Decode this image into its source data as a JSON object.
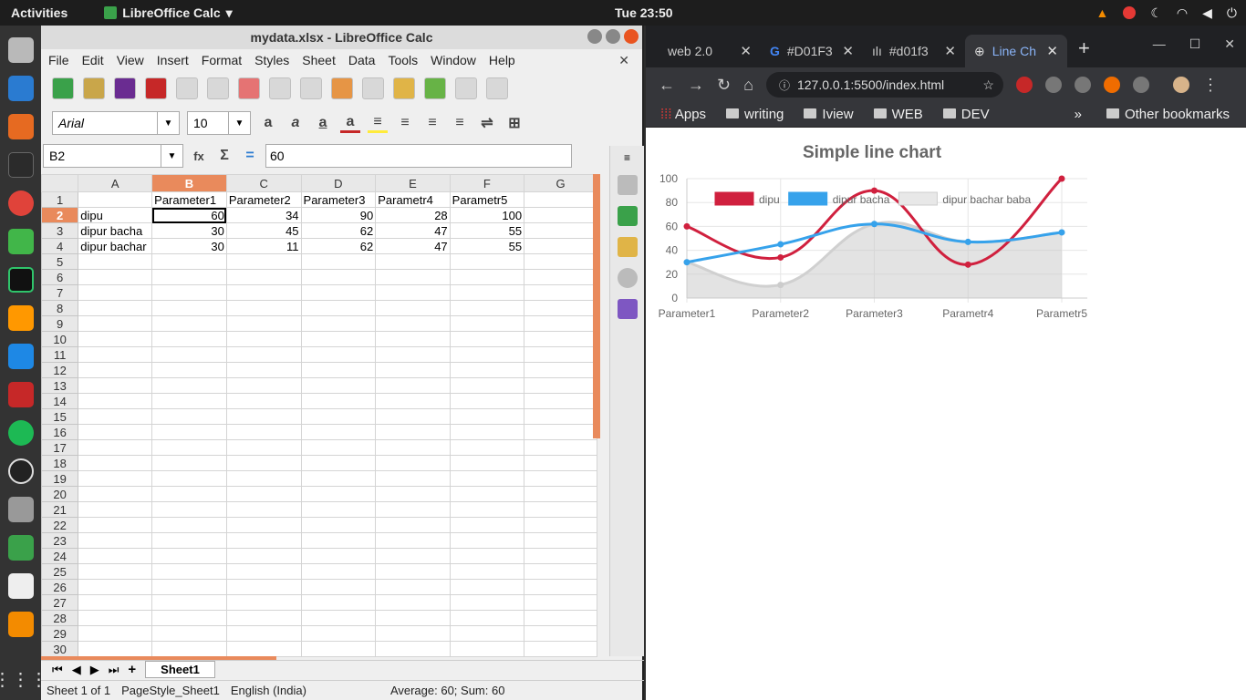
{
  "topbar": {
    "activities": "Activities",
    "app_name": "LibreOffice Calc",
    "clock": "Tue 23:50"
  },
  "calc": {
    "title": "mydata.xlsx - LibreOffice Calc",
    "menu": [
      "File",
      "Edit",
      "View",
      "Insert",
      "Format",
      "Styles",
      "Sheet",
      "Data",
      "Tools",
      "Window",
      "Help"
    ],
    "font_name": "Arial",
    "font_size": "10",
    "name_box": "B2",
    "formula_value": "60",
    "col_headers": [
      "A",
      "B",
      "C",
      "D",
      "E",
      "F",
      "G"
    ],
    "rows": [
      [
        "",
        "Parameter1",
        "Parameter2",
        "Parameter3",
        "Parametr4",
        "Parametr5",
        ""
      ],
      [
        "dipu",
        "60",
        "34",
        "90",
        "28",
        "100",
        ""
      ],
      [
        "dipur bacha",
        "30",
        "45",
        "62",
        "47",
        "55",
        ""
      ],
      [
        "dipur bachar",
        "30",
        "11",
        "62",
        "47",
        "55",
        ""
      ]
    ],
    "row_count": 30,
    "sheet_tab": "Sheet1",
    "status": {
      "sheet": "Sheet 1 of 1",
      "style": "PageStyle_Sheet1",
      "lang": "English (India)",
      "sum": "Average: 60; Sum: 60"
    }
  },
  "browser": {
    "tabs": [
      "web 2.0",
      "#D01F3",
      "#d01f3",
      "Line Ch"
    ],
    "url": "127.0.0.1:5500/index.html",
    "bookmarks": [
      "Apps",
      "writing",
      "Iview",
      "WEB",
      "DEV"
    ],
    "other_bookmarks": "Other bookmarks"
  },
  "chart_data": {
    "type": "line",
    "title": "Simple line chart",
    "categories": [
      "Parameter1",
      "Parameter2",
      "Parameter3",
      "Parametr4",
      "Parametr5"
    ],
    "series": [
      {
        "name": "dipu",
        "values": [
          60,
          34,
          90,
          28,
          100
        ],
        "color": "#d0203e",
        "fill": false
      },
      {
        "name": "dipur bacha",
        "values": [
          30,
          45,
          62,
          47,
          55
        ],
        "color": "#36a2eb",
        "fill": false
      },
      {
        "name": "dipur bachar baba",
        "values": [
          30,
          11,
          62,
          47,
          55
        ],
        "color": "#d8d8d8",
        "fill": true
      }
    ],
    "ylim": [
      0,
      100
    ],
    "yticks": [
      0,
      20,
      40,
      60,
      80,
      100
    ],
    "legend": "top"
  }
}
